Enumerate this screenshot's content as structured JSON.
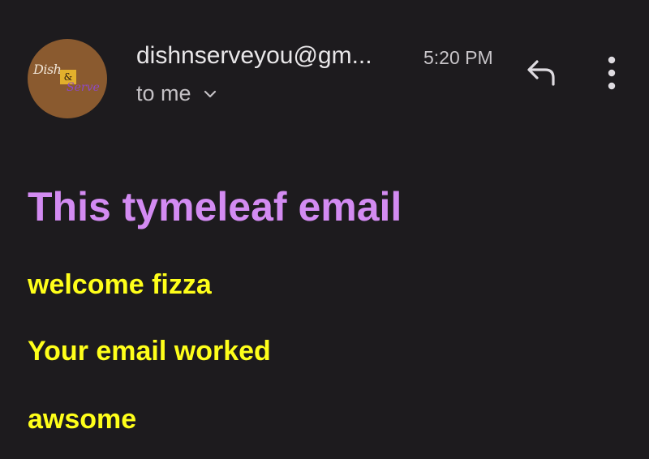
{
  "header": {
    "avatar_logo": {
      "line1": "Dish",
      "amp": "&",
      "line2": "Serve"
    },
    "sender": "dishnserveyou@gm...",
    "time": "5:20 PM",
    "recipient": "to me",
    "icons": {
      "recipient_toggle": "chevron-down-icon",
      "reply": "reply-icon",
      "more": "more-vert-icon"
    }
  },
  "body": {
    "heading": "This tymeleaf email",
    "lines": [
      "welcome fizza",
      "Your email worked",
      "awsome"
    ]
  },
  "colors": {
    "background": "#1d1b1e",
    "heading": "#d38bf2",
    "body_text": "#ffff1a",
    "avatar": "#8a5a2f"
  }
}
